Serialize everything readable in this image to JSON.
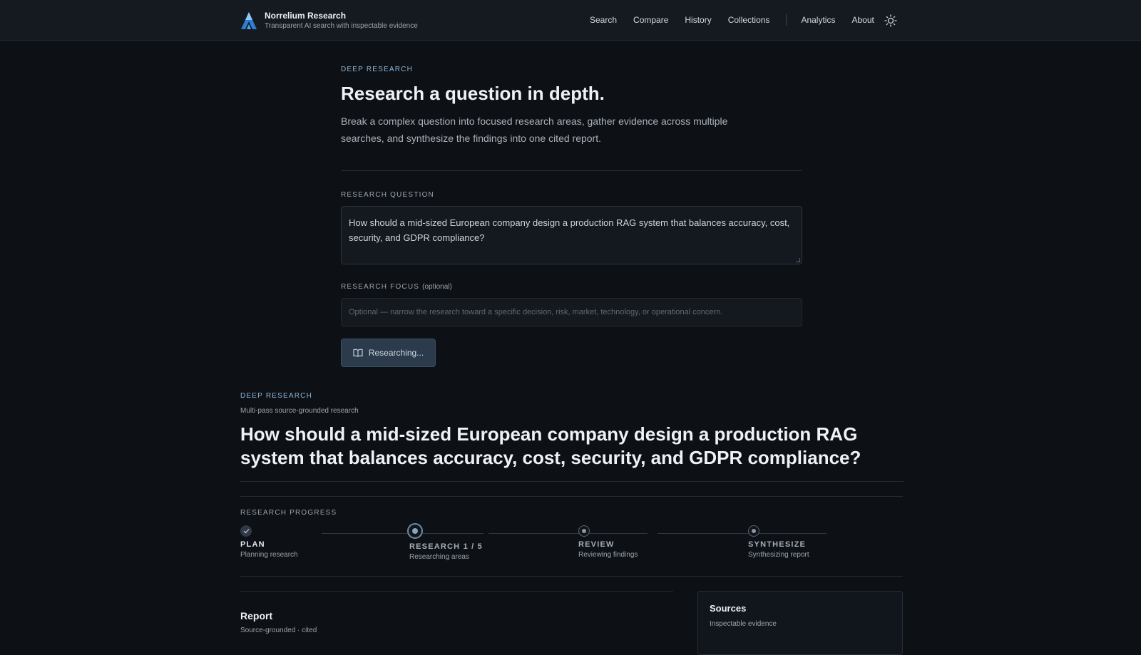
{
  "header": {
    "brand_name": "Norrelium Research",
    "brand_tagline": "Transparent AI search with inspectable evidence",
    "nav": [
      "Search",
      "Compare",
      "History",
      "Collections",
      "Analytics",
      "About"
    ]
  },
  "hero": {
    "eyebrow": "DEEP RESEARCH",
    "title": "Research a question in depth.",
    "description": "Break a complex question into focused research areas, gather evidence across multiple searches, and synthesize the findings into one cited report."
  },
  "form": {
    "question_label": "RESEARCH QUESTION",
    "question_value": "How should a mid-sized European company design a production RAG system that balances accuracy, cost, security, and GDPR compliance?",
    "focus_label": "RESEARCH FOCUS",
    "focus_optional": "(optional)",
    "focus_placeholder": "Optional — narrow the research toward a specific decision, risk, market, technology, or operational concern.",
    "button_label": "Researching..."
  },
  "result": {
    "eyebrow": "DEEP RESEARCH",
    "subtitle": "Multi-pass source-grounded research",
    "question": "How should a mid-sized European company design a production RAG system that balances accuracy, cost, security, and GDPR compliance?"
  },
  "progress": {
    "label": "RESEARCH PROGRESS",
    "steps": [
      {
        "name": "PLAN",
        "desc": "Planning research",
        "state": "done"
      },
      {
        "name": "RESEARCH 1 / 5",
        "desc": "Researching areas",
        "state": "active"
      },
      {
        "name": "REVIEW",
        "desc": "Reviewing findings",
        "state": "pending"
      },
      {
        "name": "SYNTHESIZE",
        "desc": "Synthesizing report",
        "state": "pending"
      }
    ]
  },
  "report": {
    "title": "Report",
    "subtitle": "Source-grounded · cited"
  },
  "sources": {
    "title": "Sources",
    "subtitle": "Inspectable evidence"
  },
  "colors": {
    "background": "#0d1116",
    "header": "#151a21",
    "accent": "#8fb4d6",
    "button": "#2b3b4c"
  },
  "icons": {
    "logo": "mountain-logo-icon",
    "theme": "sun-icon",
    "button": "book-open-icon",
    "done": "check-icon"
  }
}
